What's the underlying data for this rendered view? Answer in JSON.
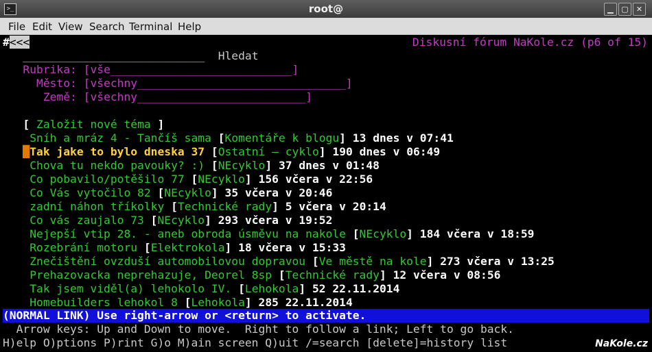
{
  "window": {
    "title": "root@",
    "minimize": "▁",
    "maximize": "▢",
    "close": "✕",
    "app_icon": ">_"
  },
  "menu": [
    "File",
    "Edit",
    "View",
    "Search",
    "Terminal",
    "Help"
  ],
  "terminal": {
    "back_prefix": "#",
    "back_link": "<<<",
    "page_header": "Diskusní fórum NaKole.cz (p6 of 15)",
    "search": {
      "field": "___________________________",
      "button": "Hledat"
    },
    "filters": [
      {
        "label": "Rubrika: ",
        "value": "[vše___________________________]"
      },
      {
        "label": "Město: ",
        "value": "[všechny_______________________________]"
      },
      {
        "label": "Země: ",
        "value": "[všechny_________________________]"
      }
    ],
    "new_topic": {
      "open": "[ ",
      "label": "Založit nové téma",
      "close": " ]"
    },
    "topics": [
      {
        "title": "Sníh a mráz 4 - Tančíš sama",
        "category": "Komentáře k blogu",
        "meta": "13 dnes v 07:41"
      },
      {
        "title": "Tak jake to bylo dneska 37",
        "category": "Ostatní – cyklo",
        "meta": "190 dnes v 06:49"
      },
      {
        "title": "Chova tu nekdo pavouky? :)",
        "category": "NEcyklo",
        "meta": "37 dnes v 01:48"
      },
      {
        "title": "Co pobavilo/potěšilo 77",
        "category": "NEcyklo",
        "meta": "156 včera v 22:56"
      },
      {
        "title": "Co Vás vytočilo 82",
        "category": "NEcyklo",
        "meta": "35 včera v 20:46"
      },
      {
        "title": "zadní náhon tříkolky",
        "category": "Technické rady",
        "meta": "5 včera v 20:14"
      },
      {
        "title": "Co vás zaujalo 73",
        "category": "NEcyklo",
        "meta": "293 včera v 19:52"
      },
      {
        "title": "Nejepší vtip 28. - aneb obroda úsměvu na nakole",
        "category": "NEcyklo",
        "meta": "184 včera v 18:59"
      },
      {
        "title": "Rozebrání motoru",
        "category": "Elektrokola",
        "meta": "18 včera v 15:33"
      },
      {
        "title": "Znečištění ovzduší automobilovou dopravou",
        "category": "Ve městě na kole",
        "meta": "273 včera v 13:25"
      },
      {
        "title": "Prehazovacka neprehazuje, Deorel 8sp",
        "category": "Technické rady",
        "meta": "12 včera v 08:56"
      },
      {
        "title": "Tak jsem viděl(a) lehokolo IV.",
        "category": "Lehokola",
        "meta": "52 22.11.2014"
      },
      {
        "title": "Homebuilders lehokol 8",
        "category": "Lehokola",
        "meta": "285 22.11.2014"
      }
    ],
    "status": "(NORMAL LINK) Use right-arrow or <return> to activate.",
    "help1": "  Arrow keys: Up and Down to move.  Right to follow a link; Left to go back.",
    "help2": "H)elp O)ptions P)rint G)o M)ain screen Q)uit /=search [delete]=history list"
  },
  "watermark": "NaKole.cz"
}
